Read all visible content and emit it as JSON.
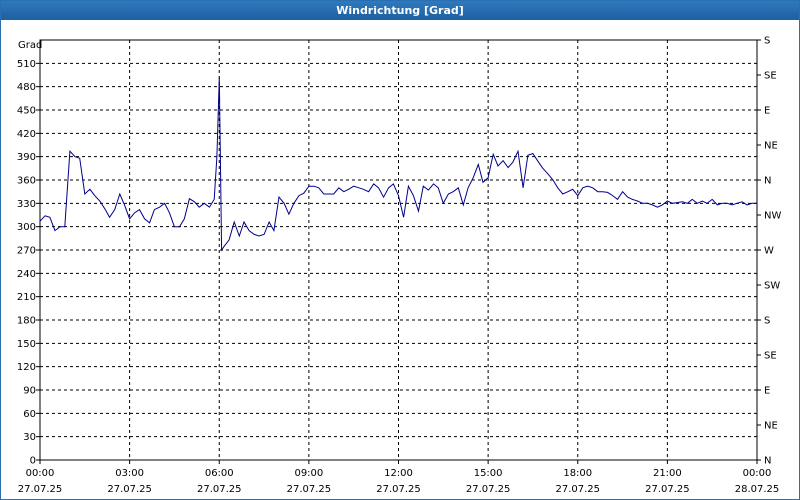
{
  "window": {
    "title": "Windrichtung [Grad]"
  },
  "chart_data": {
    "type": "line",
    "title": "Windrichtung [Grad]",
    "ylabel": "Grad",
    "ylim": [
      0,
      540
    ],
    "y_ticks": [
      0,
      30,
      60,
      90,
      120,
      150,
      180,
      210,
      240,
      270,
      300,
      330,
      360,
      390,
      420,
      450,
      480,
      510
    ],
    "right_axis": {
      "ticks": [
        0,
        45,
        90,
        135,
        180,
        225,
        270,
        315,
        360,
        405,
        450,
        495,
        540
      ],
      "labels": [
        "N",
        "NE",
        "E",
        "SE",
        "S",
        "SW",
        "W",
        "NW",
        "N",
        "NE",
        "E",
        "SE",
        "S"
      ]
    },
    "xlim": [
      0,
      24
    ],
    "x_ticks": [
      {
        "h": 0,
        "time": "00:00",
        "date": "27.07.25"
      },
      {
        "h": 3,
        "time": "03:00",
        "date": "27.07.25"
      },
      {
        "h": 6,
        "time": "06:00",
        "date": "27.07.25"
      },
      {
        "h": 9,
        "time": "09:00",
        "date": "27.07.25"
      },
      {
        "h": 12,
        "time": "12:00",
        "date": "27.07.25"
      },
      {
        "h": 15,
        "time": "15:00",
        "date": "27.07.25"
      },
      {
        "h": 18,
        "time": "18:00",
        "date": "27.07.25"
      },
      {
        "h": 21,
        "time": "21:00",
        "date": "27.07.25"
      },
      {
        "h": 24,
        "time": "00:00",
        "date": "28.07.25"
      }
    ],
    "grid": true,
    "line_color": "#00008b",
    "series": [
      {
        "x": [
          0.0,
          0.17,
          0.33,
          0.5,
          0.67,
          0.83,
          1.0,
          1.17,
          1.33,
          1.5,
          1.67,
          1.83,
          2.0,
          2.17,
          2.33,
          2.5,
          2.67,
          2.83,
          3.0,
          3.17,
          3.33,
          3.5,
          3.67,
          3.83,
          4.0,
          4.17,
          4.33,
          4.5,
          4.67,
          4.83,
          5.0,
          5.17,
          5.33,
          5.5,
          5.67,
          5.83,
          5.92,
          6.0,
          6.08,
          6.17,
          6.33,
          6.5,
          6.67,
          6.83,
          7.0,
          7.17,
          7.33,
          7.5,
          7.67,
          7.83,
          8.0,
          8.17,
          8.33,
          8.5,
          8.67,
          8.83,
          9.0,
          9.17,
          9.33,
          9.5,
          9.67,
          9.83,
          10.0,
          10.17,
          10.33,
          10.5,
          10.67,
          10.83,
          11.0,
          11.17,
          11.33,
          11.5,
          11.67,
          11.83,
          12.0,
          12.17,
          12.33,
          12.5,
          12.67,
          12.83,
          13.0,
          13.17,
          13.33,
          13.5,
          13.67,
          13.83,
          14.0,
          14.17,
          14.33,
          14.5,
          14.67,
          14.83,
          15.0,
          15.17,
          15.33,
          15.5,
          15.67,
          15.83,
          16.0,
          16.17,
          16.33,
          16.5,
          16.67,
          16.83,
          17.0,
          17.17,
          17.33,
          17.5,
          17.67,
          17.83,
          18.0,
          18.17,
          18.33,
          18.5,
          18.67,
          18.83,
          19.0,
          19.17,
          19.33,
          19.5,
          19.67,
          19.83,
          20.0,
          20.17,
          20.33,
          20.5,
          20.67,
          20.83,
          21.0,
          21.17,
          21.33,
          21.5,
          21.67,
          21.83,
          22.0,
          22.17,
          22.33,
          22.5,
          22.67,
          22.83,
          23.0,
          23.17,
          23.33,
          23.5,
          23.67,
          23.83,
          24.0
        ],
        "y": [
          307,
          314,
          312,
          295,
          300,
          300,
          397,
          390,
          388,
          342,
          348,
          340,
          333,
          323,
          312,
          322,
          342,
          328,
          310,
          318,
          322,
          310,
          305,
          322,
          325,
          330,
          318,
          300,
          300,
          310,
          336,
          332,
          325,
          330,
          325,
          335,
          390,
          492,
          270,
          275,
          283,
          306,
          288,
          306,
          295,
          290,
          288,
          290,
          306,
          295,
          338,
          330,
          316,
          330,
          340,
          343,
          352,
          352,
          350,
          342,
          342,
          342,
          350,
          345,
          348,
          352,
          350,
          348,
          345,
          355,
          350,
          338,
          350,
          355,
          340,
          312,
          352,
          340,
          320,
          352,
          347,
          355,
          350,
          330,
          342,
          345,
          350,
          328,
          350,
          363,
          380,
          357,
          363,
          393,
          378,
          385,
          376,
          383,
          397,
          350,
          392,
          394,
          384,
          375,
          368,
          360,
          350,
          342,
          345,
          348,
          340,
          350,
          352,
          350,
          345,
          345,
          344,
          340,
          335,
          345,
          338,
          335,
          333,
          330,
          330,
          328,
          325,
          328,
          333,
          330,
          331,
          332,
          330,
          335,
          330,
          333,
          330,
          335,
          328,
          330,
          330,
          328,
          330,
          332,
          328,
          330,
          330
        ]
      }
    ]
  }
}
